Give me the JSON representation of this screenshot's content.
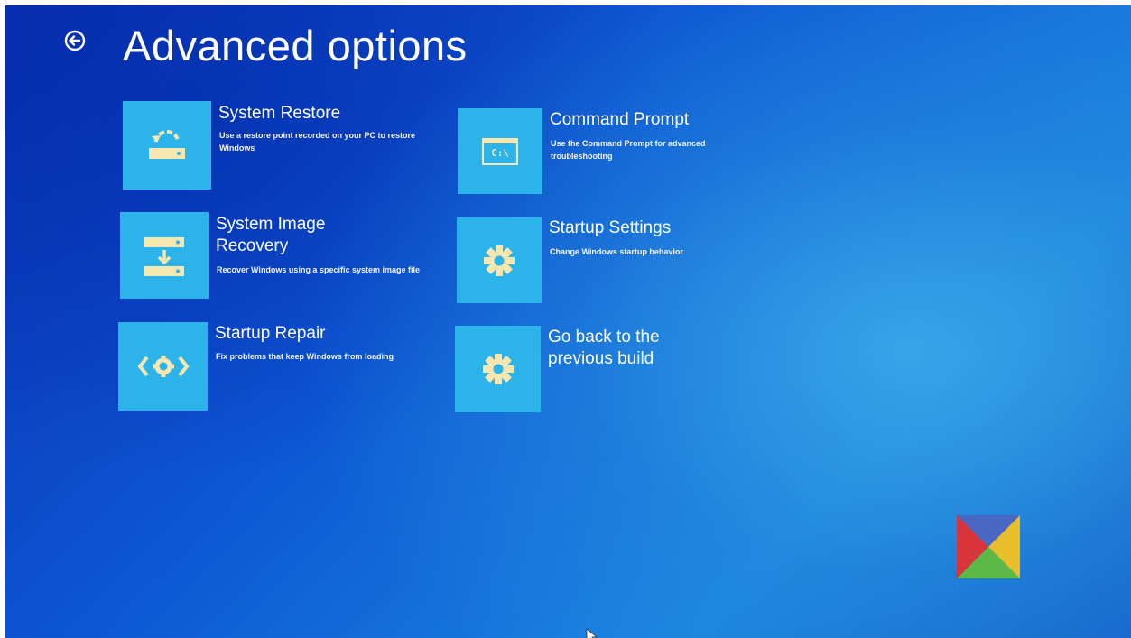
{
  "header": {
    "title": "Advanced options",
    "back_icon": "back-arrow-circle-icon"
  },
  "options": [
    {
      "id": "system-restore",
      "title": "System Restore",
      "description": "Use a restore point recorded on your PC to restore Windows",
      "icon": "restore-icon"
    },
    {
      "id": "system-image-recovery",
      "title": "System Image Recovery",
      "description": "Recover Windows using a specific system image file",
      "icon": "image-recovery-icon"
    },
    {
      "id": "startup-repair",
      "title": "Startup Repair",
      "description": "Fix problems that keep Windows from loading",
      "icon": "startup-repair-icon"
    },
    {
      "id": "command-prompt",
      "title": "Command Prompt",
      "description": "Use the Command Prompt for advanced troubleshooting",
      "icon": "command-prompt-icon",
      "icon_text": "C:\\"
    },
    {
      "id": "startup-settings",
      "title": "Startup Settings",
      "description": "Change Windows startup behavior",
      "icon": "gear-icon"
    },
    {
      "id": "go-back",
      "title": "Go back to the previous build",
      "description": "",
      "icon": "gear-icon"
    }
  ],
  "colors": {
    "tile": "#2bb3ea",
    "icon": "#f6e7b0",
    "background": "#0d56d4"
  },
  "logo": {
    "icon": "windows-insider-logo",
    "colors": [
      "#4a67c4",
      "#e8bf2a",
      "#5bb947",
      "#d8343a"
    ]
  }
}
